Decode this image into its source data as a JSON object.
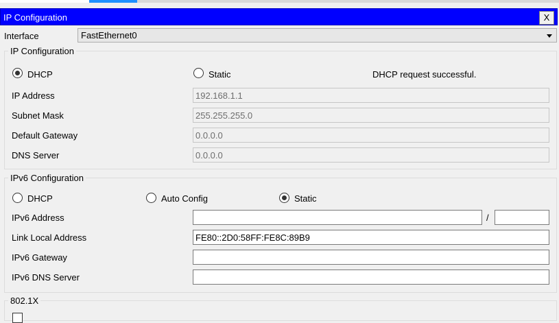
{
  "window": {
    "title": "IP Configuration",
    "close_label": "X"
  },
  "interface": {
    "label": "Interface",
    "selected": "FastEthernet0"
  },
  "ipv4": {
    "group_title": "IP Configuration",
    "mode": "DHCP",
    "dhcp_label": "DHCP",
    "static_label": "Static",
    "status": "DHCP request successful.",
    "ip_label": "IP Address",
    "ip_value": "192.168.1.1",
    "mask_label": "Subnet Mask",
    "mask_value": "255.255.255.0",
    "gateway_label": "Default Gateway",
    "gateway_value": "0.0.0.0",
    "dns_label": "DNS Server",
    "dns_value": "0.0.0.0"
  },
  "ipv6": {
    "group_title": "IPv6 Configuration",
    "mode": "Static",
    "dhcp_label": "DHCP",
    "auto_label": "Auto Config",
    "static_label": "Static",
    "address_label": "IPv6 Address",
    "address_value": "",
    "prefix_sep": "/",
    "prefix_value": "",
    "link_local_label": "Link Local Address",
    "link_local_value": "FE80::2D0:58FF:FE8C:89B9",
    "gateway_label": "IPv6 Gateway",
    "gateway_value": "",
    "dns_label": "IPv6 DNS Server",
    "dns_value": ""
  },
  "dot1x": {
    "group_title": "802.1X"
  },
  "colors": {
    "titlebar": "#0000ff",
    "tab_accent": "#1e90ff",
    "background": "#f0f0f0"
  }
}
